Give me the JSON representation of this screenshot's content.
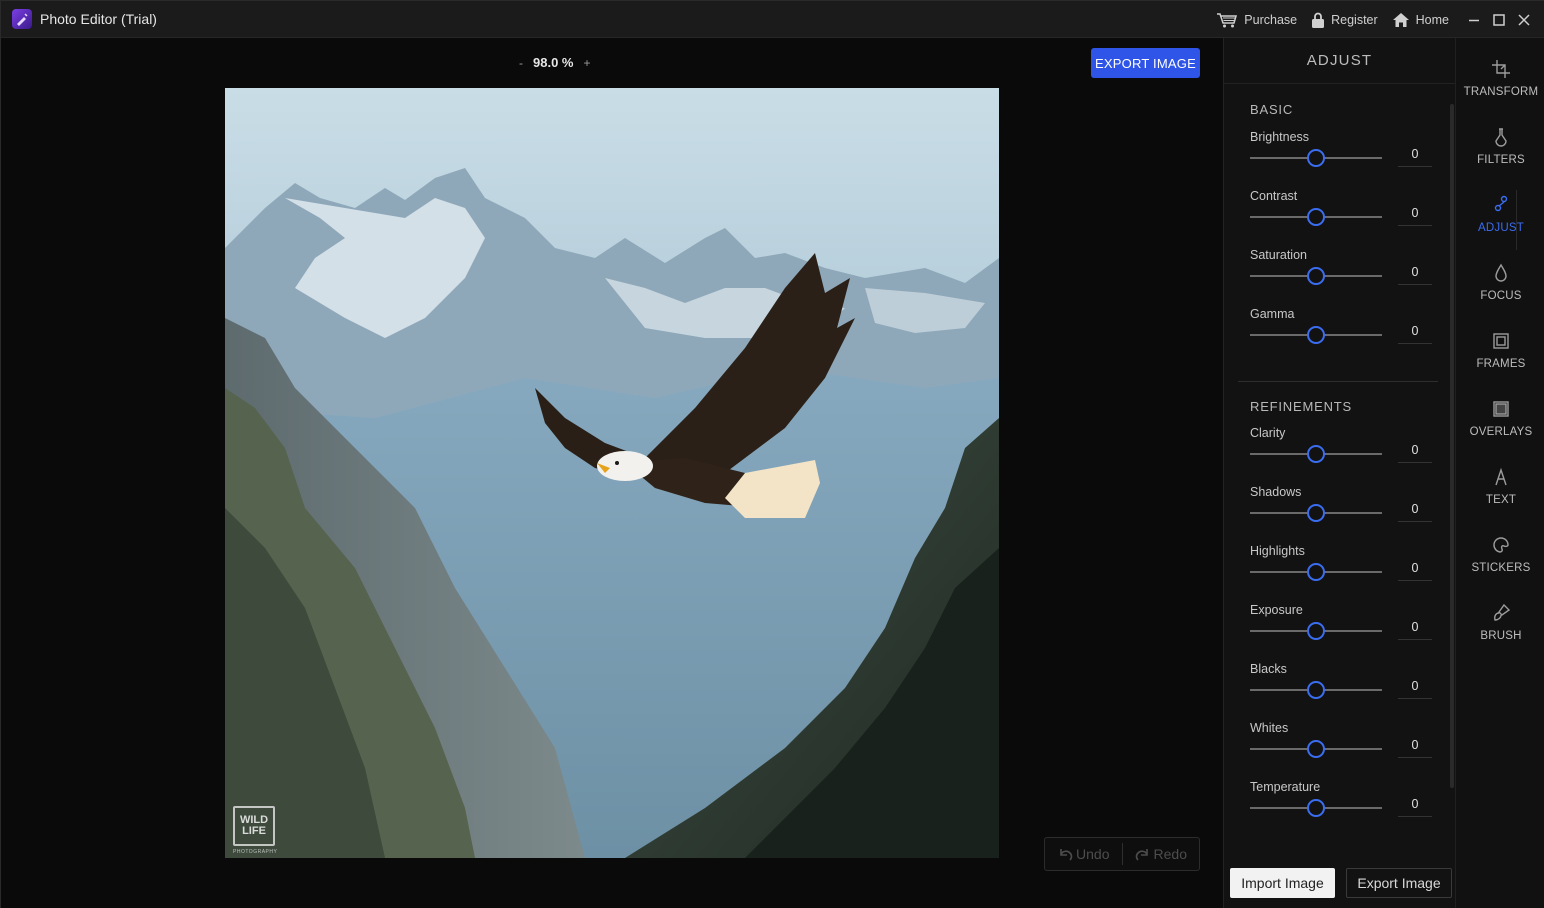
{
  "window": {
    "title": "Photo Editor (Trial)",
    "links": {
      "purchase": "Purchase",
      "register": "Register",
      "home": "Home"
    }
  },
  "canvas": {
    "zoom_minus": "-",
    "zoom_value": "98.0 %",
    "zoom_plus": "+",
    "export_top_label": "EXPORT IMAGE",
    "watermark_line1": "WILD",
    "watermark_line2": "LIFE",
    "watermark_sub": "PHOTOGRAPHY",
    "undo_label": "Undo",
    "redo_label": "Redo"
  },
  "panel": {
    "title": "ADJUST",
    "basic_title": "BASIC",
    "refinements_title": "REFINEMENTS",
    "basic": [
      {
        "label": "Brightness",
        "value": "0"
      },
      {
        "label": "Contrast",
        "value": "0"
      },
      {
        "label": "Saturation",
        "value": "0"
      },
      {
        "label": "Gamma",
        "value": "0"
      }
    ],
    "refinements": [
      {
        "label": "Clarity",
        "value": "0"
      },
      {
        "label": "Shadows",
        "value": "0"
      },
      {
        "label": "Highlights",
        "value": "0"
      },
      {
        "label": "Exposure",
        "value": "0"
      },
      {
        "label": "Blacks",
        "value": "0"
      },
      {
        "label": "Whites",
        "value": "0"
      },
      {
        "label": "Temperature",
        "value": "0"
      }
    ],
    "import_label": "Import Image",
    "export_label": "Export Image"
  },
  "tools": [
    {
      "label": "TRANSFORM",
      "icon": "crop-icon",
      "active": false
    },
    {
      "label": "FILTERS",
      "icon": "flask-icon",
      "active": false
    },
    {
      "label": "ADJUST",
      "icon": "adjust-icon",
      "active": true
    },
    {
      "label": "FOCUS",
      "icon": "drop-icon",
      "active": false
    },
    {
      "label": "FRAMES",
      "icon": "frame-icon",
      "active": false
    },
    {
      "label": "OVERLAYS",
      "icon": "overlay-icon",
      "active": false
    },
    {
      "label": "TEXT",
      "icon": "text-icon",
      "active": false
    },
    {
      "label": "STICKERS",
      "icon": "sticker-icon",
      "active": false
    },
    {
      "label": "BRUSH",
      "icon": "brush-icon",
      "active": false
    }
  ],
  "colors": {
    "accent": "#3a6df0",
    "export_button": "#2f55e8",
    "panel_bg": "#121212",
    "canvas_bg": "#0a0a0a"
  }
}
